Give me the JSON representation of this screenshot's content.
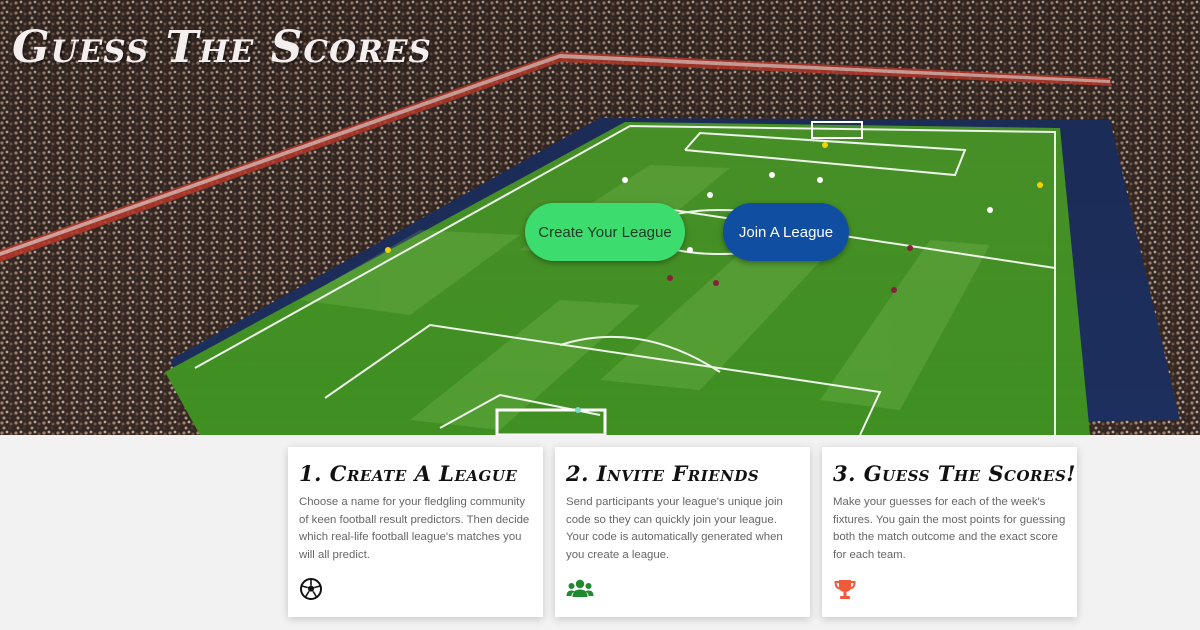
{
  "hero": {
    "title": "Guess The Scores",
    "create_button": "Create Your League",
    "join_button": "Join A League"
  },
  "steps": [
    {
      "title": "1. Create A League",
      "text": "Choose a name for your fledgling community of keen football result predictors. Then decide which real-life football league's matches you will all predict.",
      "icon": "soccer-ball-icon",
      "icon_color": "#111111"
    },
    {
      "title": "2. Invite Friends",
      "text": "Send participants your league's unique join code so they can quickly join your league. Your code is automatically generated when you create a league.",
      "icon": "users-icon",
      "icon_color": "#1f8a2e"
    },
    {
      "title": "3. Guess The Scores!",
      "text": "Make your guesses for each of the week's fixtures. You gain the most points for guessing both the match outcome and the exact score for each team.",
      "icon": "trophy-icon",
      "icon_color": "#f05a3a"
    }
  ],
  "colors": {
    "create_button_bg": "#3ddc6e",
    "join_button_bg": "#0f4ea0",
    "page_bg": "#f2f2f2"
  }
}
